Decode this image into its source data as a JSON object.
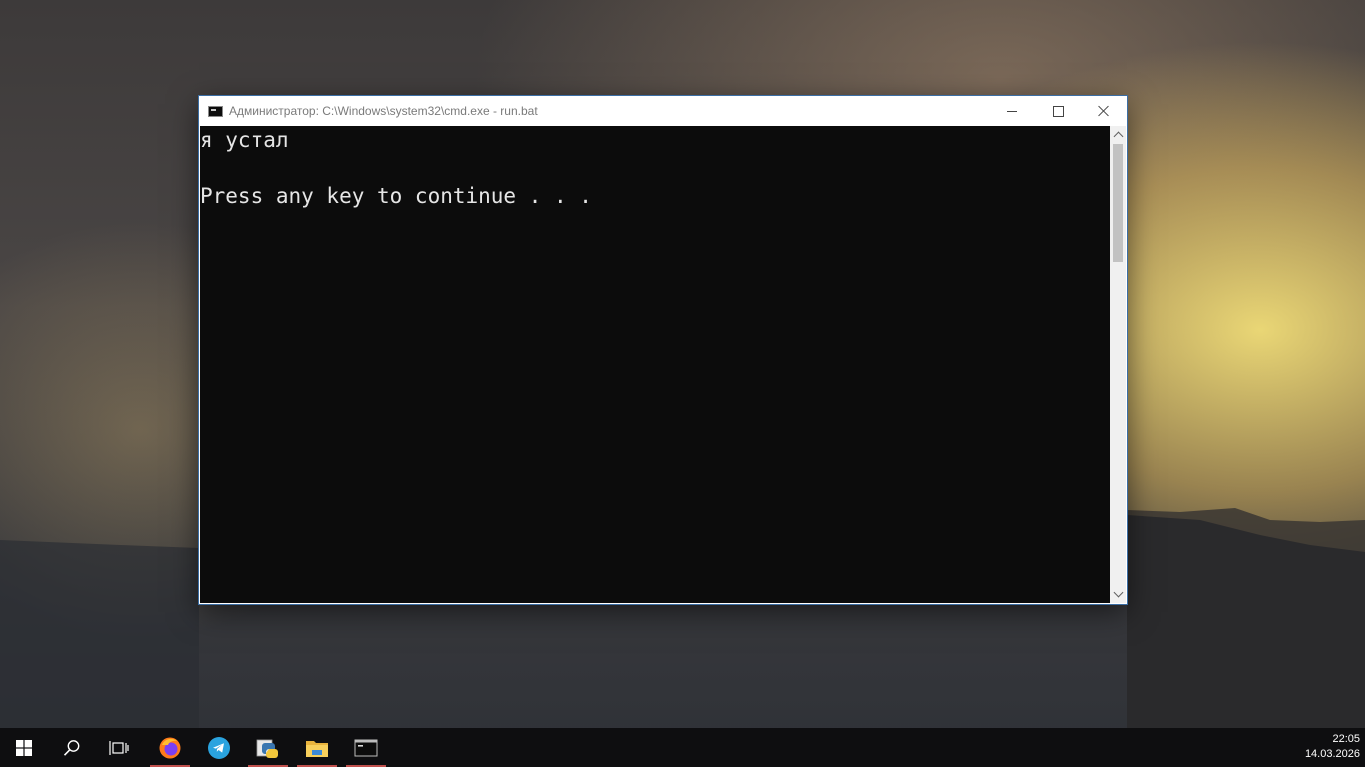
{
  "window": {
    "title": "Администратор: C:\\Windows\\system32\\cmd.exe - run.bat",
    "icon": "cmd-icon",
    "controls": [
      "minimize-icon",
      "maximize-icon",
      "close-icon"
    ]
  },
  "console": {
    "lines": [
      "я устал",
      "Press any key to continue . . ."
    ],
    "background": "#0c0c0c",
    "foreground": "#e6e6e6"
  },
  "taskbar": {
    "items": [
      {
        "icon": "windows-start-icon",
        "running": false
      },
      {
        "icon": "search-icon",
        "running": false
      },
      {
        "icon": "task-view-icon",
        "running": false
      },
      {
        "icon": "firefox-icon",
        "running": true
      },
      {
        "icon": "telegram-icon",
        "running": false
      },
      {
        "icon": "python-idle-icon",
        "running": true
      },
      {
        "icon": "file-explorer-icon",
        "running": true
      },
      {
        "icon": "cmd-icon",
        "running": true
      }
    ],
    "clock": {
      "time": "22:05",
      "date": "14.03.2026"
    }
  }
}
